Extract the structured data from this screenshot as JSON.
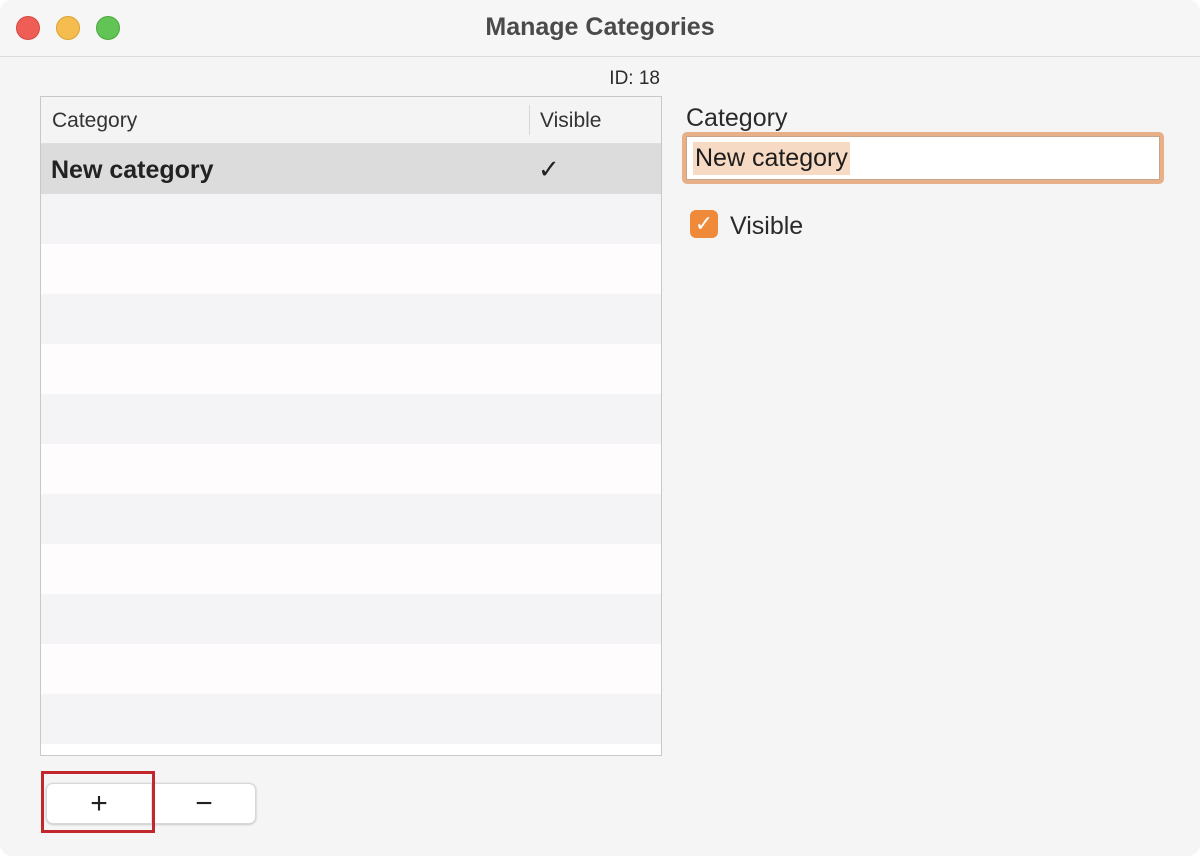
{
  "window": {
    "title": "Manage Categories"
  },
  "id_label": "ID: 18",
  "table": {
    "columns": [
      "Category",
      "Visible"
    ],
    "rows": [
      {
        "name": "New category",
        "visible": "✓",
        "selected": true
      }
    ],
    "empty_rows": 11
  },
  "buttons": {
    "add_label": "+",
    "remove_label": "−"
  },
  "detail": {
    "field_label": "Category",
    "field_value": "New category",
    "checkbox_checked": true,
    "checkbox_label": "Visible"
  },
  "colors": {
    "accent": "#ee8a3a",
    "focus_ring": "#e8b089",
    "selection_highlight": "#c1272d"
  }
}
